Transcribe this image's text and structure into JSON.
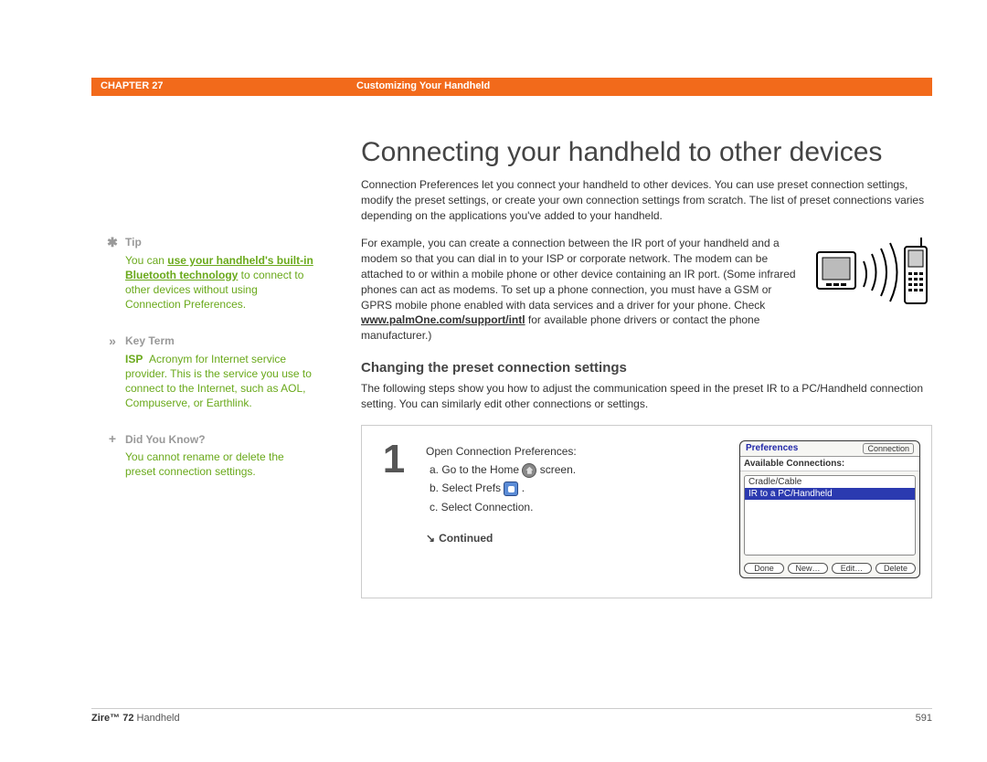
{
  "header": {
    "chapter_label": "CHAPTER 27",
    "chapter_title": "Customizing Your Handheld"
  },
  "sidebar": {
    "tip": {
      "heading": "Tip",
      "text_before": "You can ",
      "link_text": "use your handheld's built-in Bluetooth technology",
      "text_after": " to connect to other devices without using Connection Preferences."
    },
    "keyterm": {
      "heading": "Key Term",
      "term": "ISP",
      "definition": "Acronym for Internet service provider. This is the service you use to connect to the Internet, such as AOL, Compuserve, or Earthlink."
    },
    "dyk": {
      "heading": "Did You Know?",
      "text": "You cannot rename or delete the preset connection settings."
    }
  },
  "main": {
    "h1": "Connecting your handheld to other devices",
    "intro": "Connection Preferences let you connect your handheld to other devices. You can use preset connection settings, modify the preset settings, or create your own connection settings from scratch. The list of preset connections varies depending on the applications you've added to your handheld.",
    "example_before": "For example, you can create a connection between the IR port of your handheld and a modem so that you can dial in to your ISP or corporate network. The modem can be attached to or within a mobile phone or other device containing an IR port. (Some infrared phones can act as modems. To set up a phone connection, you must have a GSM or GPRS mobile phone enabled with data services and a driver for your phone. Check ",
    "example_link": "www.palmOne.com/support/intl",
    "example_after": " for available phone drivers or contact the phone manufacturer.)",
    "section_h": "Changing the preset connection settings",
    "section_intro": "The following steps show you how to adjust the communication speed in the preset IR to a PC/Handheld connection setting. You can similarly edit other connections or settings.",
    "step": {
      "num": "1",
      "lead": "Open Connection Preferences:",
      "a_before": "a.  Go to the Home ",
      "a_after": " screen.",
      "b_before": "b.  Select Prefs ",
      "b_after": " .",
      "c": "c.  Select Connection.",
      "continued": "Continued"
    },
    "palm": {
      "title_left": "Preferences",
      "title_right": "Connection",
      "subhead": "Available Connections:",
      "item1": "Cradle/Cable",
      "item2": "IR to a PC/Handheld",
      "btn_done": "Done",
      "btn_new": "New…",
      "btn_edit": "Edit…",
      "btn_delete": "Delete"
    }
  },
  "footer": {
    "product_bold": "Zire™ 72",
    "product_rest": " Handheld",
    "page": "591"
  }
}
